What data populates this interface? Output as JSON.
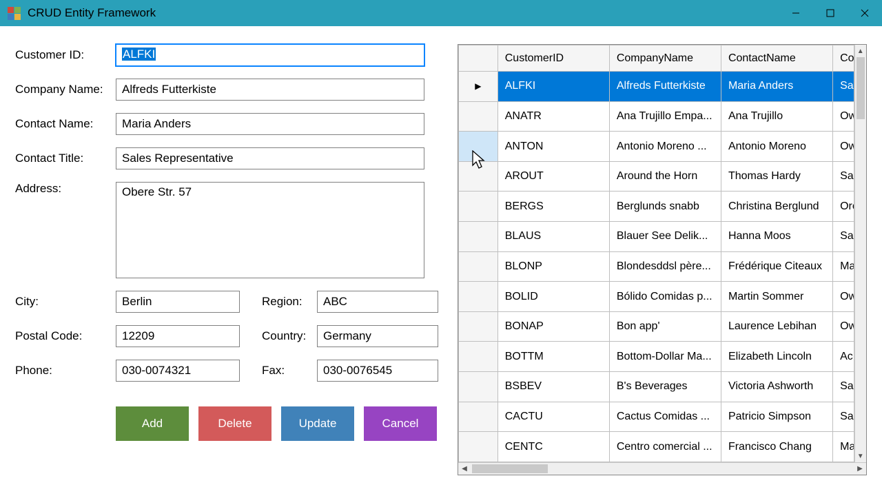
{
  "window": {
    "title": "CRUD Entity Framework"
  },
  "form": {
    "labels": {
      "customer_id": "Customer ID:",
      "company_name": "Company Name:",
      "contact_name": "Contact Name:",
      "contact_title": "Contact Title:",
      "address": "Address:",
      "city": "City:",
      "region": "Region:",
      "postal_code": "Postal Code:",
      "country": "Country:",
      "phone": "Phone:",
      "fax": "Fax:"
    },
    "values": {
      "customer_id": "ALFKI",
      "company_name": "Alfreds Futterkiste",
      "contact_name": "Maria Anders",
      "contact_title": "Sales Representative",
      "address": "Obere Str. 57",
      "city": "Berlin",
      "region": "ABC",
      "postal_code": "12209",
      "country": "Germany",
      "phone": "030-0074321",
      "fax": "030-0076545"
    }
  },
  "buttons": {
    "add": "Add",
    "delete": "Delete",
    "update": "Update",
    "cancel": "Cancel"
  },
  "grid": {
    "columns": [
      "CustomerID",
      "CompanyName",
      "ContactName",
      "Co"
    ],
    "rows": [
      {
        "id": "ALFKI",
        "company": "Alfreds Futterkiste",
        "contact": "Maria Anders",
        "ct": "Sa",
        "selected": true,
        "indicator": "▶"
      },
      {
        "id": "ANATR",
        "company": "Ana Trujillo Empa...",
        "contact": "Ana Trujillo",
        "ct": "Ow"
      },
      {
        "id": "ANTON",
        "company": "Antonio Moreno ...",
        "contact": "Antonio Moreno",
        "ct": "Ow",
        "hover": true
      },
      {
        "id": "AROUT",
        "company": "Around the Horn",
        "contact": "Thomas Hardy",
        "ct": "Sa"
      },
      {
        "id": "BERGS",
        "company": "Berglunds snabb",
        "contact": "Christina Berglund",
        "ct": "Orc"
      },
      {
        "id": "BLAUS",
        "company": "Blauer See Delik...",
        "contact": "Hanna Moos",
        "ct": "Sa"
      },
      {
        "id": "BLONP",
        "company": "Blondesddsl père...",
        "contact": "Frédérique Citeaux",
        "ct": "Ma"
      },
      {
        "id": "BOLID",
        "company": "Bólido Comidas p...",
        "contact": "Martin Sommer",
        "ct": "Ow"
      },
      {
        "id": "BONAP",
        "company": "Bon app'",
        "contact": "Laurence Lebihan",
        "ct": "Ow"
      },
      {
        "id": "BOTTM",
        "company": "Bottom-Dollar Ma...",
        "contact": "Elizabeth Lincoln",
        "ct": "Ac"
      },
      {
        "id": "BSBEV",
        "company": "B's Beverages",
        "contact": "Victoria Ashworth",
        "ct": "Sa"
      },
      {
        "id": "CACTU",
        "company": "Cactus Comidas ...",
        "contact": "Patricio Simpson",
        "ct": "Sa"
      },
      {
        "id": "CENTC",
        "company": "Centro comercial ...",
        "contact": "Francisco Chang",
        "ct": "Ma"
      }
    ]
  }
}
